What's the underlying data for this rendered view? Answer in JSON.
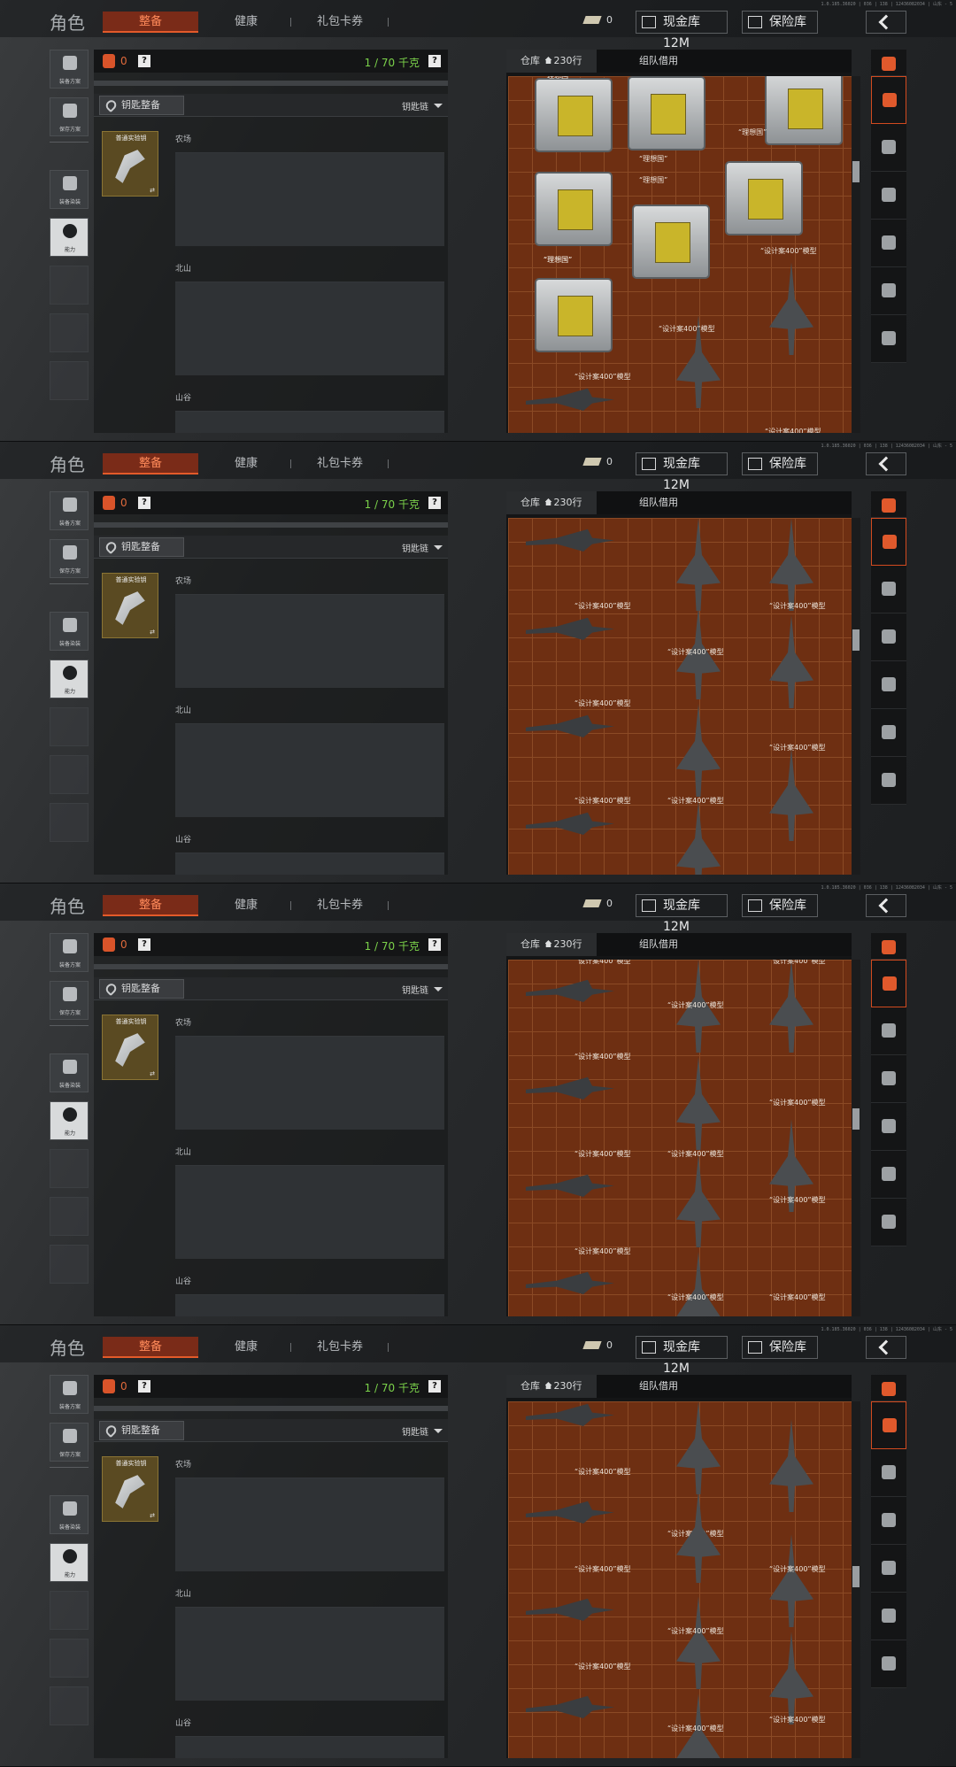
{
  "build": "1.0.185.36020 | 036 | 138 | 12436082034 | 山东 - 5",
  "header": {
    "title": "角色",
    "tabs": [
      {
        "label": "整备",
        "active": true
      },
      {
        "label": "健康",
        "active": false
      },
      {
        "label": "礼包卡券",
        "active": false
      }
    ],
    "key_count": "0",
    "cash_button": "现金库 12M",
    "safe_button": "保险库"
  },
  "left_bar": [
    {
      "label": "装备方案"
    },
    {
      "label": "保存方案"
    },
    {
      "label": "装备染装"
    },
    {
      "label": "能力"
    }
  ],
  "equip": {
    "bag_count": "0",
    "help": "?",
    "weight": "1 / 70 千克",
    "key_slot": "钥匙整备",
    "key_dropdown": "钥匙链",
    "key_item": {
      "name": "普通实验钥",
      "mark": "⇄"
    },
    "maps": [
      "农场",
      "北山",
      "山谷"
    ]
  },
  "warehouse": {
    "tab_label": "仓库",
    "tab_count": "230行",
    "other_tab": "组队借用"
  },
  "item_labels": {
    "crate": "“理想国”",
    "jet": "“设计案400”模型"
  },
  "colors": {
    "accent": "#e35a2a",
    "weight_green": "#7bd24a",
    "inventory_bg": "#6e2f12"
  }
}
